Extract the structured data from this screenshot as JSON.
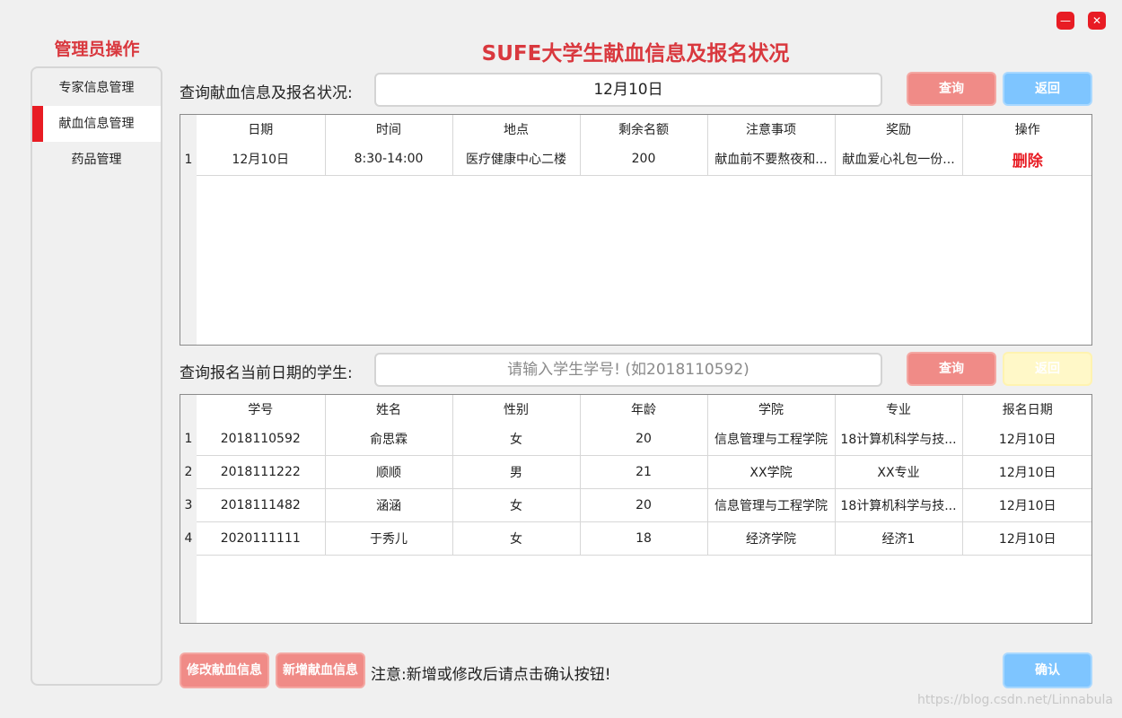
{
  "window": {
    "minimize_glyph": "—",
    "close_glyph": "✕"
  },
  "sidebar": {
    "title": "管理员操作",
    "items": [
      {
        "label": "专家信息管理",
        "active": false
      },
      {
        "label": "献血信息管理",
        "active": true
      },
      {
        "label": "药品管理",
        "active": false
      }
    ]
  },
  "header": {
    "title": "SUFE大学生献血信息及报名状况"
  },
  "donation_query": {
    "label": "查询献血信息及报名状况:",
    "input_value": "12月10日",
    "query_button": "查询",
    "back_button": "返回"
  },
  "donation_table": {
    "columns": [
      "日期",
      "时间",
      "地点",
      "剩余名额",
      "注意事项",
      "奖励",
      "操作"
    ],
    "rows": [
      {
        "index": "1",
        "cells": [
          "12月10日",
          "8:30-14:00",
          "医疗健康中心二楼",
          "200",
          "献血前不要熬夜和...",
          "献血爱心礼包一份..."
        ],
        "action": "删除"
      }
    ]
  },
  "student_query": {
    "label": "查询报名当前日期的学生:",
    "placeholder": "请输入学生学号!  (如2018110592)",
    "query_button": "查询",
    "back_button": "返回"
  },
  "student_table": {
    "columns": [
      "学号",
      "姓名",
      "性别",
      "年龄",
      "学院",
      "专业",
      "报名日期"
    ],
    "rows": [
      {
        "index": "1",
        "cells": [
          "2018110592",
          "俞思霖",
          "女",
          "20",
          "信息管理与工程学院",
          "18计算机科学与技...",
          "12月10日"
        ]
      },
      {
        "index": "2",
        "cells": [
          "2018111222",
          "顺顺",
          "男",
          "21",
          "XX学院",
          "XX专业",
          "12月10日"
        ]
      },
      {
        "index": "3",
        "cells": [
          "2018111482",
          "涵涵",
          "女",
          "20",
          "信息管理与工程学院",
          "18计算机科学与技...",
          "12月10日"
        ]
      },
      {
        "index": "4",
        "cells": [
          "2020111111",
          "于秀儿",
          "女",
          "18",
          "经济学院",
          "经济1",
          "12月10日"
        ]
      }
    ]
  },
  "footer": {
    "modify_button": "修改献血信息",
    "add_button": "新增献血信息",
    "note": "注意:新增或修改后请点击确认按钮!",
    "confirm_button": "确认",
    "watermark": "https://blog.csdn.net/Linnabula"
  },
  "colors": {
    "accent_red": "#e81c24",
    "title_red": "#d9383e",
    "button_red": "#f08b87",
    "button_blue": "#7ec5ff",
    "button_yellow": "#fff8c8"
  }
}
